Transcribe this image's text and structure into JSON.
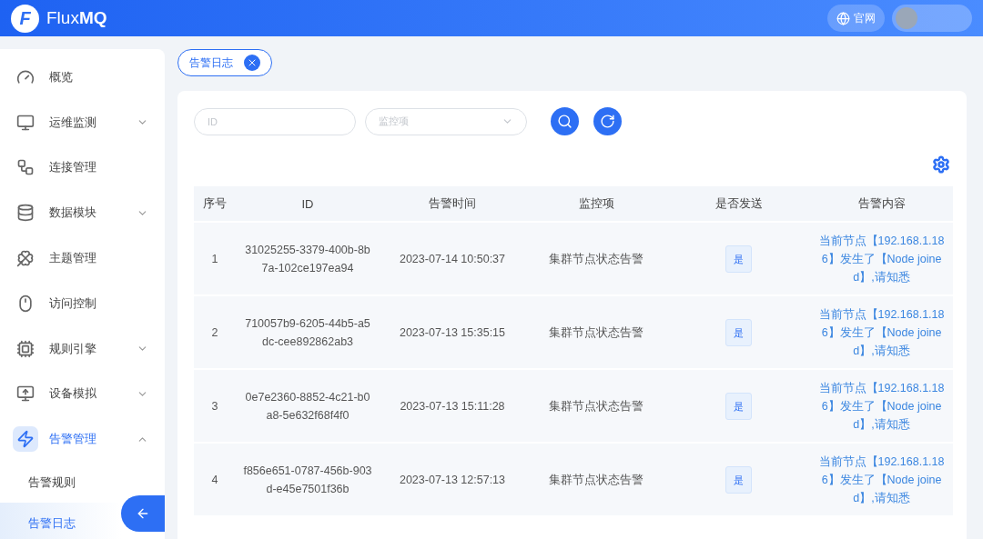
{
  "header": {
    "logo_letter": "F",
    "brand_light": "Flux",
    "brand_bold": "MQ",
    "site_button": "官网"
  },
  "sidebar": {
    "items": [
      {
        "label": "概览",
        "kind": "link",
        "selected": false
      },
      {
        "label": "运维监测",
        "kind": "group",
        "selected": false,
        "expanded": false
      },
      {
        "label": "连接管理",
        "kind": "link",
        "selected": false
      },
      {
        "label": "数据模块",
        "kind": "group",
        "selected": false,
        "expanded": false
      },
      {
        "label": "主题管理",
        "kind": "link",
        "selected": false
      },
      {
        "label": "访问控制",
        "kind": "link",
        "selected": false
      },
      {
        "label": "规则引擎",
        "kind": "group",
        "selected": false,
        "expanded": false
      },
      {
        "label": "设备模拟",
        "kind": "group",
        "selected": false,
        "expanded": false
      },
      {
        "label": "告警管理",
        "kind": "group",
        "selected": true,
        "expanded": true,
        "children": [
          {
            "label": "告警规则",
            "selected": false
          },
          {
            "label": "告警日志",
            "selected": true
          }
        ]
      }
    ]
  },
  "tabs": [
    {
      "label": "告警日志",
      "selected": true
    }
  ],
  "filters": {
    "id_placeholder": "ID",
    "monitor_placeholder": "监控项"
  },
  "table": {
    "columns": [
      "序号",
      "ID",
      "告警时间",
      "监控项",
      "是否发送",
      "告警内容"
    ],
    "rows": [
      {
        "index": "1",
        "id": "31025255-3379-400b-8b7a-102ce197ea94",
        "time": "2023-07-14 10:50:37",
        "monitor": "集群节点状态告警",
        "sent": "是",
        "content": "当前节点【192.168.1.186】发生了【Node joined】,请知悉"
      },
      {
        "index": "2",
        "id": "710057b9-6205-44b5-a5dc-cee892862ab3",
        "time": "2023-07-13 15:35:15",
        "monitor": "集群节点状态告警",
        "sent": "是",
        "content": "当前节点【192.168.1.186】发生了【Node joined】,请知悉"
      },
      {
        "index": "3",
        "id": "0e7e2360-8852-4c21-b0a8-5e632f68f4f0",
        "time": "2023-07-13 15:11:28",
        "monitor": "集群节点状态告警",
        "sent": "是",
        "content": "当前节点【192.168.1.186】发生了【Node joined】,请知悉"
      },
      {
        "index": "4",
        "id": "f856e651-0787-456b-903d-e45e7501f36b",
        "time": "2023-07-13 12:57:13",
        "monitor": "集群节点状态告警",
        "sent": "是",
        "content": "当前节点【192.168.1.186】发生了【Node joined】,请知悉"
      }
    ]
  }
}
